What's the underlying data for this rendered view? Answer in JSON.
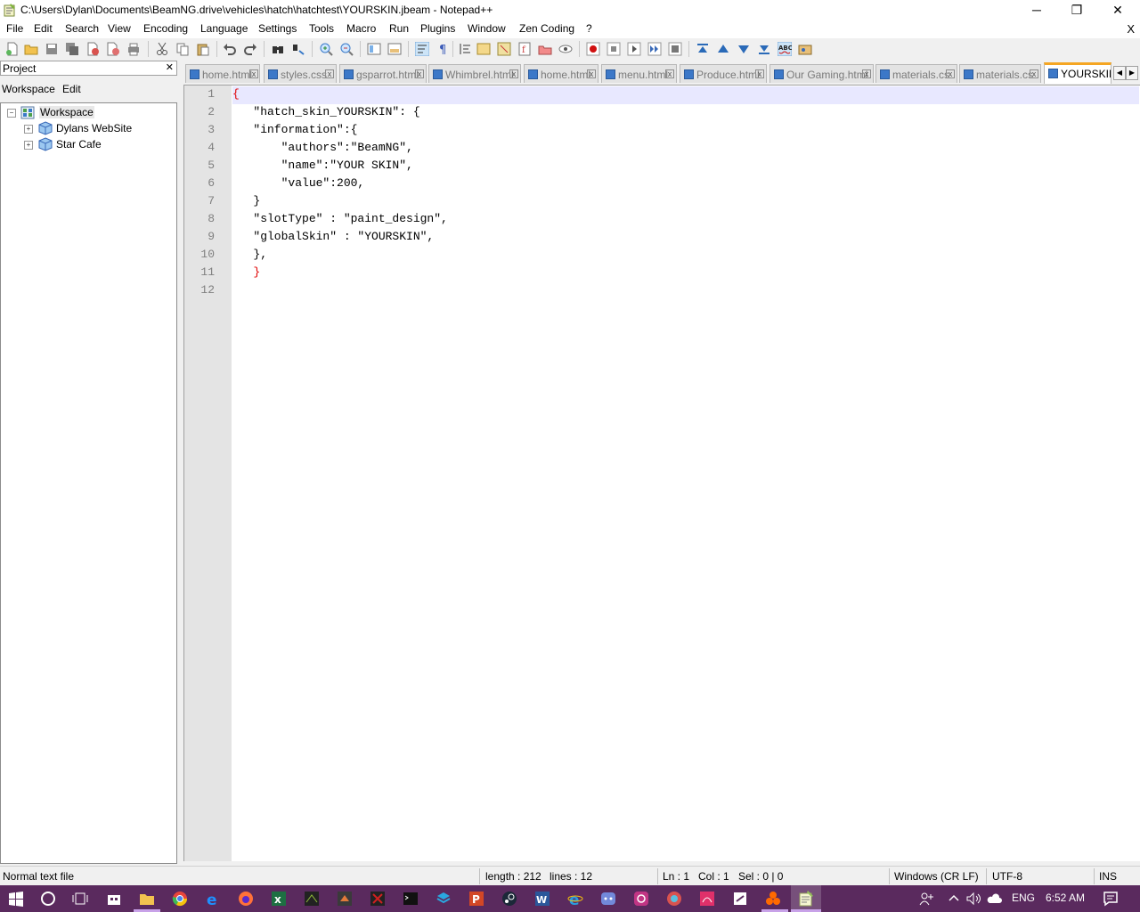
{
  "window": {
    "title": "C:\\Users\\Dylan\\Documents\\BeamNG.drive\\vehicles\\hatch\\hatchtest\\YOURSKIN.jbeam - Notepad++",
    "minimize_glyph": "─",
    "restore_glyph": "❐",
    "close_glyph": "✕"
  },
  "menu": {
    "items": [
      "File",
      "Edit",
      "Search",
      "View",
      "Encoding",
      "Language",
      "Settings",
      "Tools",
      "Macro",
      "Run",
      "Plugins",
      "Window",
      "Zen Coding",
      "?"
    ],
    "close_glyph": "X"
  },
  "project_panel": {
    "header": "Project",
    "close_glyph": "✕",
    "menu": [
      "Workspace",
      "Edit"
    ],
    "tree": {
      "root": "Workspace",
      "children": [
        "Dylans WebSite",
        "Star Cafe"
      ]
    }
  },
  "tabs": [
    {
      "label": "home.html"
    },
    {
      "label": "styles.css"
    },
    {
      "label": "gsparrot.html"
    },
    {
      "label": "Whimbrel.html"
    },
    {
      "label": "home.html"
    },
    {
      "label": "menu.html"
    },
    {
      "label": "Produce.html"
    },
    {
      "label": "Our Gaming.html"
    },
    {
      "label": "materials.cs"
    },
    {
      "label": "materials.cs"
    },
    {
      "label": "YOURSKIN"
    }
  ],
  "tab_close_glyph": "x",
  "tab_nav": {
    "left": "◀",
    "right": "▶"
  },
  "editor": {
    "line_numbers": [
      "1",
      "2",
      "3",
      "4",
      "5",
      "6",
      "7",
      "8",
      "9",
      "10",
      "11",
      "12"
    ],
    "lines": [
      "{",
      "   \"hatch_skin_YOURSKIN\": {",
      "   \"information\":{",
      "       \"authors\":\"BeamNG\",",
      "       \"name\":\"YOUR SKIN\",",
      "       \"value\":200,",
      "   }",
      "   \"slotType\" : \"paint_design\",",
      "   \"globalSkin\" : \"YOURSKIN\",",
      "   },",
      "   }",
      ""
    ]
  },
  "status": {
    "file_type": "Normal text file",
    "length": "length : 212",
    "lines": "lines : 12",
    "ln": "Ln : 1",
    "col": "Col : 1",
    "sel": "Sel : 0 | 0",
    "eol": "Windows (CR LF)",
    "encoding": "UTF-8",
    "mode": "INS"
  },
  "taskbar": {
    "lang": "ENG",
    "time": "6:52 AM"
  },
  "colors": {
    "brace": "#e00000",
    "active_tab_accent": "#f5a623",
    "taskbar": "#5a2a5e",
    "current_line": "#e8e8ff"
  }
}
